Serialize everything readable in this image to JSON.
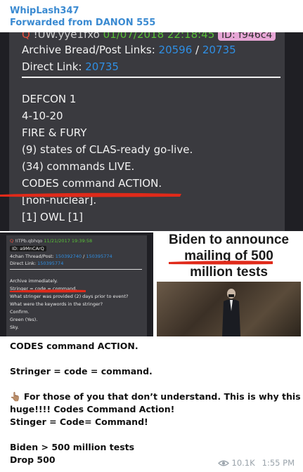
{
  "message": {
    "sender": "WhipLash347",
    "forwarded_label": "Forwarded from DANON 555",
    "views": "10.1K",
    "time": "1:55 PM"
  },
  "post1": {
    "q": "Q",
    "anon": "!UW.yye1fxo",
    "date": "01/07/2018 22:18:45",
    "id": "ID: f946c4",
    "archive_label": "Archive Bread/Post Links:",
    "link1": "20596",
    "slash": "/",
    "link2": "20735",
    "direct_label": "Direct Link:",
    "direct_link": "20735",
    "lines": [
      "DEFCON 1",
      "4-10-20",
      "FIRE & FURY",
      "(9) states of CLAS-ready go-live.",
      "(34) commands LIVE.",
      "CODES command ACTION.",
      "[non-nuclear].",
      "[1] OWL [1]"
    ]
  },
  "post2": {
    "q": "Q",
    "anon": "!ITPb.qbhqo",
    "date": "11/21/2017 19:39:58",
    "id": "ID: a9MnCArQ",
    "thread_label": "4chan Thread/Post:",
    "thread1": "150392740",
    "thread2": "150395774",
    "direct_label": "Direct Link:",
    "direct_link": "150395774",
    "lines": [
      "Archive immediately.",
      "Stringer = code = command.",
      "What stringer was provided (2) days prior to event?",
      "What were the keywords in the stringer?",
      "Confirm.",
      "Green (Yes).",
      "Sky."
    ]
  },
  "news": {
    "line1": "Biden to announce",
    "line2": "mailing of 500",
    "line3": "million tests"
  },
  "caption": {
    "lines": [
      "CODES command ACTION.",
      "",
      "Stringer = code = command.",
      "",
      "👆🏽 For those of you that don’t understand. This is why this is",
      "huge!!!! Codes Command Action!",
      "Stinger = Code= Command!",
      "",
      "Biden > 500 million tests",
      "Drop 500"
    ]
  },
  "colors": {
    "accent": "#3a8ad1",
    "link": "#2f8fe4",
    "underline": "#e02a1a"
  }
}
